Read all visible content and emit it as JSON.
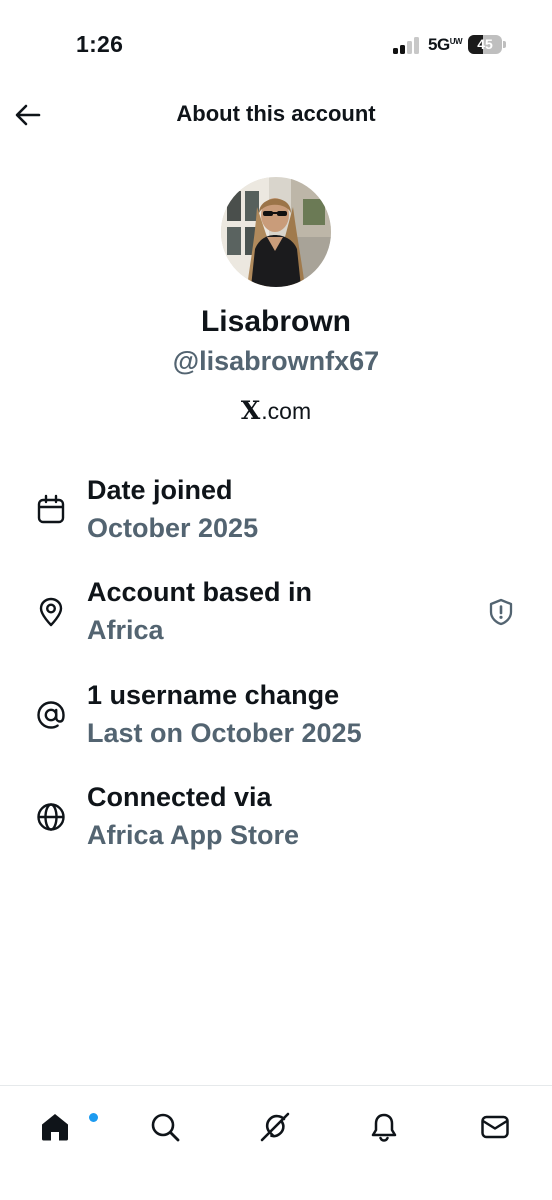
{
  "status_bar": {
    "time": "1:26",
    "network": "5G",
    "network_sup": "UW",
    "battery": "45",
    "battery_level": 0.45
  },
  "header": {
    "title": "About this account",
    "back_icon": "arrow-left-icon"
  },
  "profile": {
    "display_name": "Lisabrown",
    "handle": "@lisabrownfx67",
    "site_logo": "X",
    "site_suffix": ".com"
  },
  "info": [
    {
      "icon": "calendar-icon",
      "label": "Date joined",
      "value": "October 2025"
    },
    {
      "icon": "location-pin-icon",
      "label": "Account based in",
      "value": "Africa",
      "trailing_icon": "shield-alert-icon"
    },
    {
      "icon": "at-sign-icon",
      "label": "1 username change",
      "value": "Last on October 2025"
    },
    {
      "icon": "globe-icon",
      "label": "Connected via",
      "value": "Africa App Store"
    }
  ],
  "bottom_nav": [
    {
      "icon": "home-icon",
      "active": true,
      "notification_dot": true
    },
    {
      "icon": "search-icon"
    },
    {
      "icon": "grok-icon"
    },
    {
      "icon": "bell-icon"
    },
    {
      "icon": "mail-icon"
    }
  ],
  "colors": {
    "text_primary": "#0f1419",
    "text_secondary": "#536471",
    "accent_blue": "#1d9bf0",
    "background": "#ffffff"
  }
}
